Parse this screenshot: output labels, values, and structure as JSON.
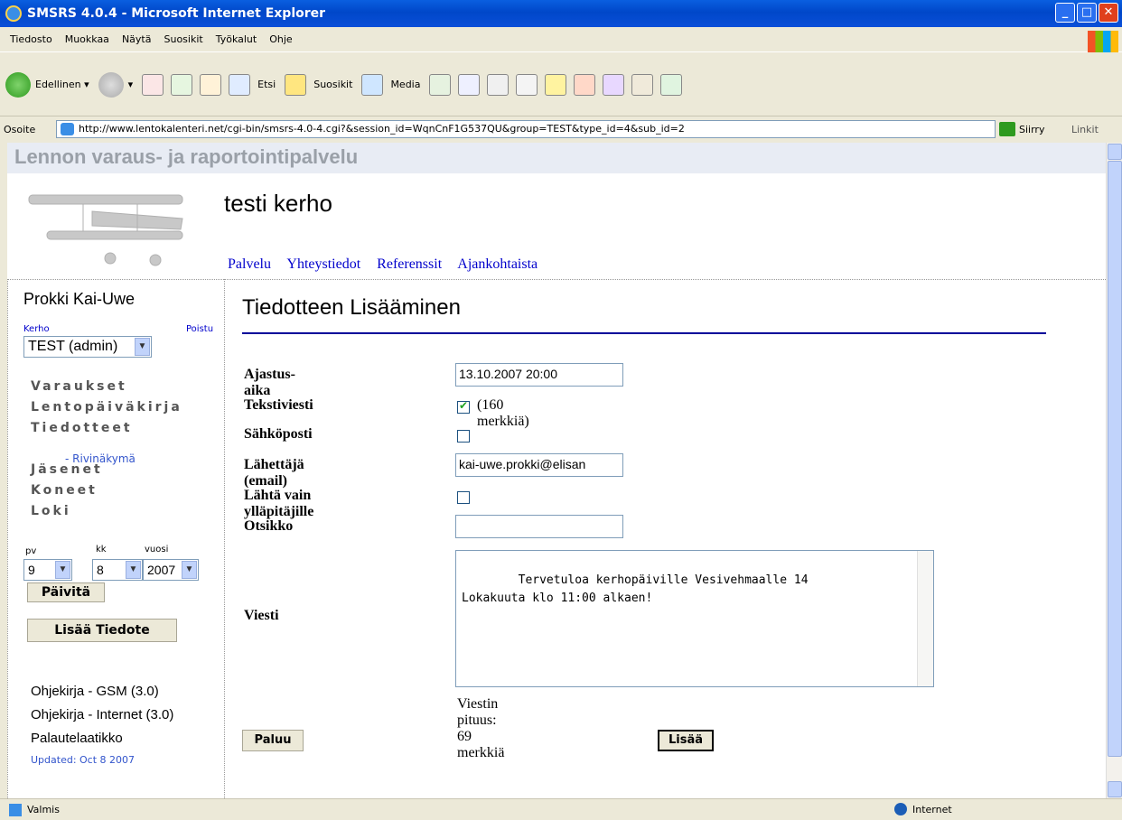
{
  "window": {
    "title": "SMSRS 4.0.4 - Microsoft Internet Explorer"
  },
  "menu": [
    "Tiedosto",
    "Muokkaa",
    "Näytä",
    "Suosikit",
    "Työkalut",
    "Ohje"
  ],
  "toolbar": {
    "back": "Edellinen",
    "search": "Etsi",
    "favorites": "Suosikit",
    "media": "Media"
  },
  "address": {
    "label": "Osoite",
    "url": "http://www.lentokalenteri.net/cgi-bin/smsrs-4.0-4.cgi?&session_id=WqnCnF1G537QU&group=TEST&type_id=4&sub_id=2",
    "go": "Siirry",
    "links": "Linkit"
  },
  "status": {
    "text": "Valmis",
    "zone": "Internet"
  },
  "site": {
    "banner": "Lennon varaus- ja raportointipalvelu",
    "club": "testi kerho",
    "nav": [
      "Palvelu",
      "Yhteystiedot",
      "Referenssit",
      "Ajankohtaista"
    ]
  },
  "sidebar": {
    "user": "Prokki Kai-Uwe",
    "kerho_label": "Kerho",
    "logout": "Poistu",
    "group_selected": "TEST (admin)",
    "links": [
      "Varaukset",
      "Lentopäiväkirja",
      "Tiedotteet",
      "Jäsenet",
      "Koneet",
      "Loki"
    ],
    "sublink": "- Rivinäkymä",
    "date_labels": {
      "day": "pv",
      "month": "kk",
      "year": "vuosi"
    },
    "date": {
      "day": "9",
      "month": "8",
      "year": "2007"
    },
    "refresh": "Päivitä",
    "add_notice": "Lisää Tiedote",
    "help": [
      "Ohjekirja - GSM (3.0)",
      "Ohjekirja - Internet (3.0)",
      "Palautelaatikko"
    ],
    "updated": "Updated: Oct 8 2007"
  },
  "form": {
    "title": "Tiedotteen Lisääminen",
    "labels": {
      "schedule": "Ajastus-aika",
      "sms": "Tekstiviesti",
      "email": "Sähköposti",
      "sender": "Lähettäjä (email)",
      "admins": "Lähtä vain ylläpitäjille",
      "subject": "Otsikko",
      "message": "Viesti"
    },
    "schedule_value": "13.10.2007 20:00",
    "sms_checked": true,
    "sms_note": "(160 merkkiä)",
    "email_checked": false,
    "sender_value": "kai-uwe.prokki@elisan",
    "admins_checked": false,
    "subject_value": "",
    "message_value": "Tervetuloa kerhopäiville Vesivehmaalle 14\nLokakuuta klo 11:00 alkaen!",
    "length_text": "Viestin pituus: 69 merkkiä",
    "back_button": "Paluu",
    "add_button": "Lisää"
  }
}
